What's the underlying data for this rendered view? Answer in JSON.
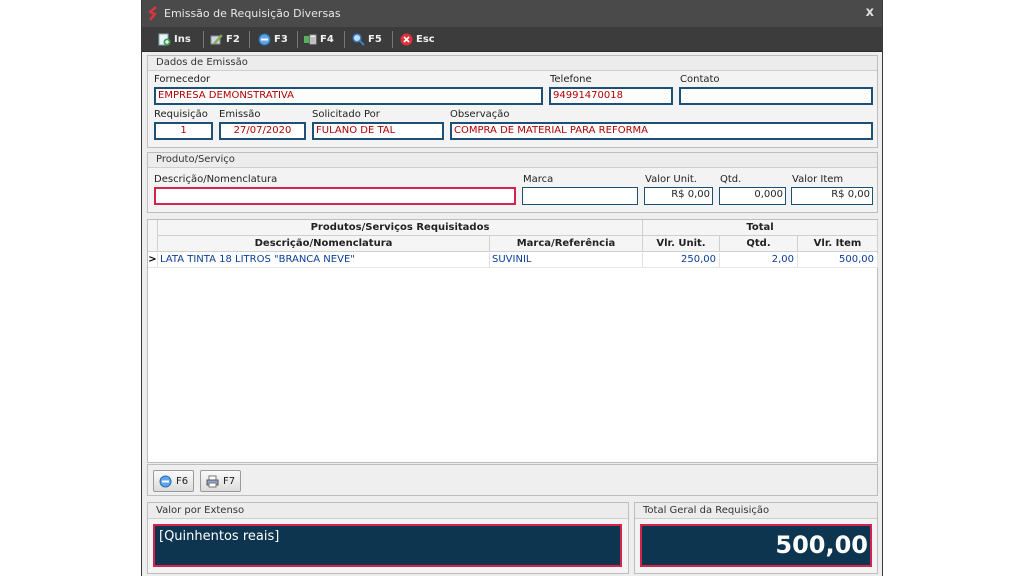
{
  "window": {
    "title": "Emissão de Requisição Diversas",
    "close_label": "x"
  },
  "toolbar": [
    {
      "label": "Ins",
      "icon": "insert-icon"
    },
    {
      "label": "F2",
      "icon": "edit-icon"
    },
    {
      "label": "F3",
      "icon": "remove-icon"
    },
    {
      "label": "F4",
      "icon": "list-icon"
    },
    {
      "label": "F5",
      "icon": "search-icon"
    },
    {
      "label": "Esc",
      "icon": "exit-icon"
    }
  ],
  "emissao": {
    "heading": "Dados de Emissão",
    "fornecedor_label": "Fornecedor",
    "fornecedor": "EMPRESA DEMONSTRATIVA",
    "telefone_label": "Telefone",
    "telefone": "94991470018",
    "contato_label": "Contato",
    "contato": "",
    "requisicao_label": "Requisição",
    "requisicao": "1",
    "emissao_label": "Emissão",
    "emissao": "27/07/2020",
    "solicitado_label": "Solicitado Por",
    "solicitado": "FULANO DE TAL",
    "observacao_label": "Observação",
    "observacao": "COMPRA DE MATERIAL PARA REFORMA"
  },
  "produto": {
    "heading": "Produto/Serviço",
    "descricao_label": "Descrição/Nomenclatura",
    "descricao": "",
    "marca_label": "Marca",
    "marca": "",
    "valor_unit_label": "Valor Unit.",
    "valor_unit": "R$ 0,00",
    "qtd_label": "Qtd.",
    "qtd": "0,000",
    "valor_item_label": "Valor Item",
    "valor_item": "R$ 0,00"
  },
  "grid": {
    "band_left": "Produtos/Serviços Requisitados",
    "band_right": "Total",
    "columns": [
      "Descrição/Nomenclatura",
      "Marca/Referência",
      "Vlr. Unit.",
      "Qtd.",
      "Vlr. Item"
    ],
    "rows": [
      {
        "descricao": "LATA TINTA 18 LITROS \"BRANCA NEVE\"",
        "marca": "SUVINIL",
        "vlr_unit": "250,00",
        "qtd": "2,00",
        "vlr_item": "500,00"
      }
    ],
    "row_indicator": ">"
  },
  "bottom_buttons": [
    {
      "label": "F6",
      "icon": "remove-icon"
    },
    {
      "label": "F7",
      "icon": "print-icon"
    }
  ],
  "extenso": {
    "heading": "Valor por Extenso",
    "value": "[Quinhentos reais]"
  },
  "total": {
    "heading": "Total Geral da Requisição",
    "value": "500,00"
  },
  "colors": {
    "accent_border": "#d4234d",
    "field_border": "#1e4f74",
    "dark_panel": "#0d3550"
  }
}
